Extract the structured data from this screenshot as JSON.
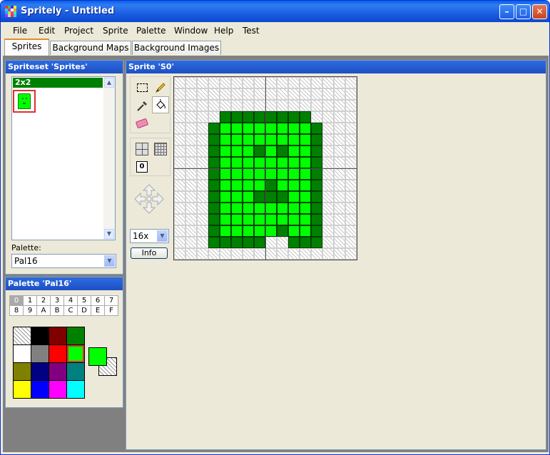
{
  "window": {
    "title": "Spritely - Untitled"
  },
  "menu": [
    "File",
    "Edit",
    "Project",
    "Sprite",
    "Palette",
    "Window",
    "Help",
    "Test"
  ],
  "tabs": [
    "Sprites",
    "Background Maps",
    "Background Images"
  ],
  "spriteset_panel": {
    "title": "Spriteset 'Sprites'",
    "group_label": "2x2",
    "palette_label": "Palette:",
    "palette_value": "Pal16"
  },
  "palette_panel": {
    "title": "Palette 'Pal16'",
    "subpalettes": [
      "0",
      "1",
      "2",
      "3",
      "4",
      "5",
      "6",
      "7",
      "8",
      "9",
      "A",
      "B",
      "C",
      "D",
      "E",
      "F"
    ],
    "selected_subpalette": "0",
    "colors": [
      "transparent",
      "#000000",
      "#800000",
      "#008000",
      "#ffffff",
      "#808080",
      "#ff0000",
      "#00ff00",
      "#808000",
      "#000080",
      "#800080",
      "#008080",
      "#ffff00",
      "#0000ff",
      "#ff00ff",
      "#00ffff"
    ],
    "selected_color_index": 7,
    "foreground": "#00ff00",
    "background": "transparent"
  },
  "sprite_panel": {
    "title": "Sprite 'S0'",
    "zoom": "16x",
    "info_label": "Info",
    "palette_index_label": "0",
    "pixels": [
      "0000000000000000",
      "0000000000000000",
      "0000000000000000",
      "0000444444440000",
      "0004777777774000",
      "0004777777774000",
      "0004777474774000",
      "0004777777774000",
      "0004777777774000",
      "0004777747774000",
      "0004777444774000",
      "0004777777774000",
      "0004777777774000",
      "0004777774774000",
      "0004444400444000",
      "0000000000000000"
    ],
    "pixel_colors": {
      "4": "#008000",
      "7": "#00ff00"
    }
  }
}
